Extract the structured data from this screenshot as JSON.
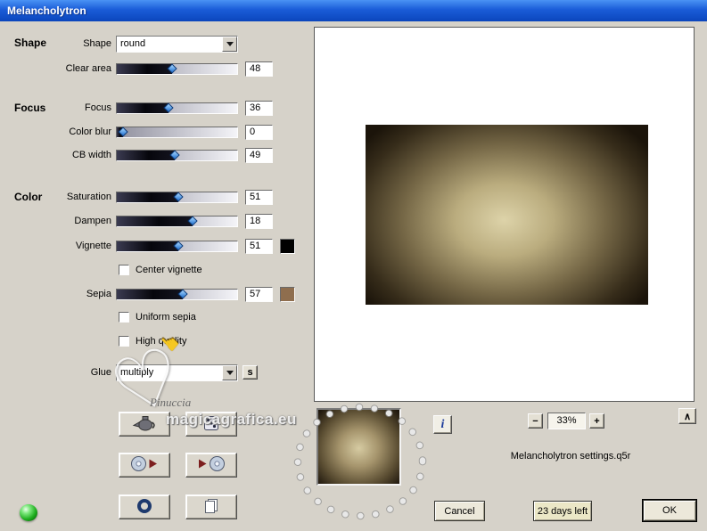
{
  "window": {
    "title": "Melancholytron"
  },
  "sections": {
    "shape": "Shape",
    "focus": "Focus",
    "color": "Color"
  },
  "controls": {
    "shape": {
      "label": "Shape",
      "value": "round"
    },
    "clear_area": {
      "label": "Clear area",
      "value": "48",
      "fill": 46
    },
    "focus": {
      "label": "Focus",
      "value": "36",
      "fill": 43
    },
    "color_blur": {
      "label": "Color blur",
      "value": "0",
      "fill": 5
    },
    "cb_width": {
      "label": "CB width",
      "value": "49",
      "fill": 48
    },
    "saturation": {
      "label": "Saturation",
      "value": "51",
      "fill": 51
    },
    "dampen": {
      "label": "Dampen",
      "value": "18",
      "fill": 63
    },
    "vignette": {
      "label": "Vignette",
      "value": "51",
      "fill": 51,
      "swatch_color": "#000000"
    },
    "center_vignette": {
      "label": "Center vignette",
      "checked": false
    },
    "sepia": {
      "label": "Sepia",
      "value": "57",
      "fill": 55,
      "swatch_color": "#8f6e4e"
    },
    "uniform_sepia": {
      "label": "Uniform sepia",
      "checked": false
    },
    "high_quality": {
      "label": "High quality",
      "checked": false
    },
    "glue": {
      "label": "Glue",
      "value": "multiply"
    }
  },
  "preview": {
    "zoom_level": "33%",
    "settings_name": "Melancholytron settings.q5r"
  },
  "actions": {
    "cancel": "Cancel",
    "days_left": "23 days left",
    "ok": "OK"
  },
  "watermark": {
    "name": "Pinuccia",
    "site": "magicagrafica.eu"
  },
  "icons": {
    "info": "i",
    "zoom_out": "−",
    "zoom_in": "+",
    "collapse": "∧",
    "glue_aux": "s",
    "hand_cursor": "☛"
  },
  "colors": {
    "titlebar_top": "#4a93f4",
    "titlebar_bottom": "#0b46bc",
    "dialog_bg": "#d6d2c9",
    "image_center": "#ddd3a9",
    "image_edge": "#1b140a",
    "vignette_swatch": "#000000",
    "sepia_swatch": "#8f6e4e"
  }
}
